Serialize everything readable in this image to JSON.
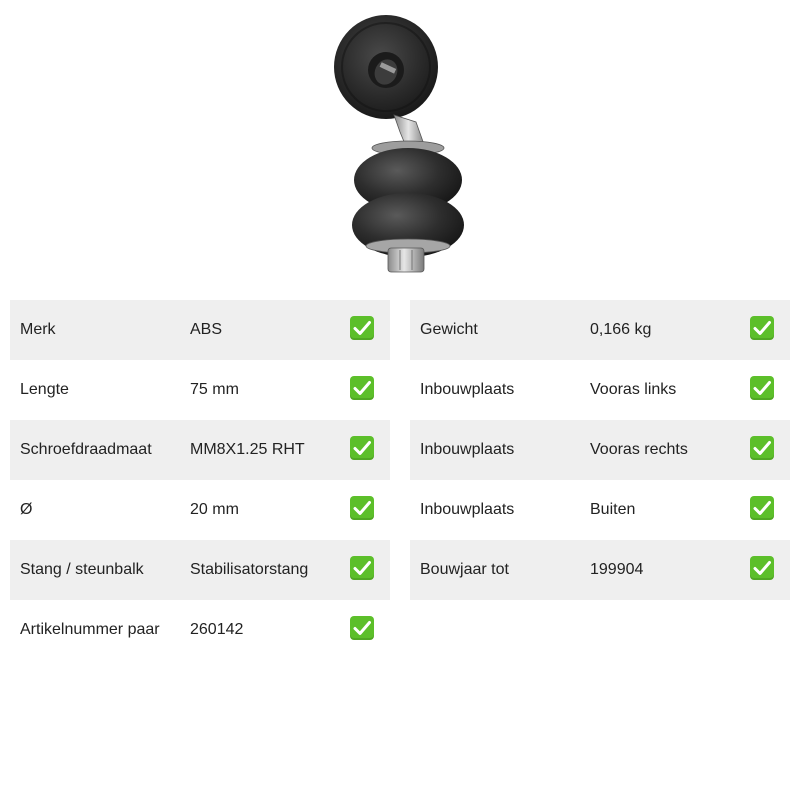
{
  "product": {
    "image_icon": "sway-bar-link-photo"
  },
  "colors": {
    "row_shade": "#efefef",
    "check_green": "#5cbf2a",
    "text": "#222222"
  },
  "specs": {
    "left": [
      {
        "label": "Merk",
        "value": "ABS",
        "icon": "checkmark-icon"
      },
      {
        "label": "Lengte",
        "value": "75 mm",
        "icon": "checkmark-icon"
      },
      {
        "label": "Schroefdraadmaat",
        "value": "MM8X1.25 RHT",
        "icon": "checkmark-icon"
      },
      {
        "label": "Ø",
        "value": "20 mm",
        "icon": "checkmark-icon"
      },
      {
        "label": "Stang / steunbalk",
        "value": "Stabilisatorstang",
        "icon": "checkmark-icon"
      },
      {
        "label": "Artikelnummer paar",
        "value": "260142",
        "icon": "checkmark-icon"
      }
    ],
    "right": [
      {
        "label": "Gewicht",
        "value": "0,166 kg",
        "icon": "checkmark-icon"
      },
      {
        "label": "Inbouwplaats",
        "value": "Vooras links",
        "icon": "checkmark-icon"
      },
      {
        "label": "Inbouwplaats",
        "value": "Vooras rechts",
        "icon": "checkmark-icon"
      },
      {
        "label": "Inbouwplaats",
        "value": "Buiten",
        "icon": "checkmark-icon"
      },
      {
        "label": "Bouwjaar tot",
        "value": "199904",
        "icon": "checkmark-icon"
      }
    ]
  }
}
